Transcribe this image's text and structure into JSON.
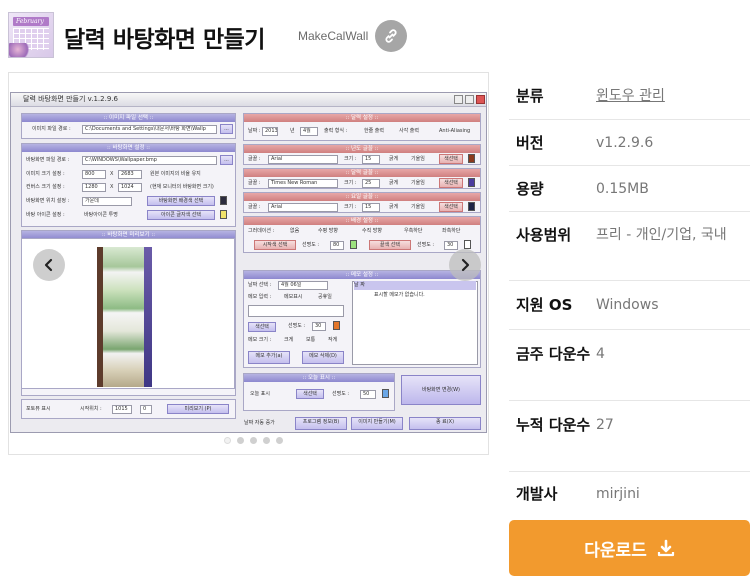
{
  "header": {
    "title": "달력 바탕화면 만들기",
    "subtitle": "MakeCalWall",
    "icon_month_text": "February"
  },
  "gallery": {
    "dot_count": 5,
    "active_dot": 0
  },
  "screenshot": {
    "window_title": "달력 바탕화면 만들기 v.1.2.9.6",
    "panel_image_file": ":: 이미지 파일 선택 ::",
    "image_file_label": "이미지 파일 경로 :",
    "image_file_path": "C:\\Documents and Settings\\내문서\\바탕 화면\\Wallp",
    "panel_wallpaper_settings": ":: 바탕화면 설정 ::",
    "wallpaper_file_label": "바탕화면 파일 경로 :",
    "wallpaper_file_path": "C:\\WINDOWS\\Wallpaper.bmp",
    "image_size_label": "이미지 크기 설정 :",
    "image_size_w": "800",
    "image_size_h": "2683",
    "keep_ratio": "원본 이미지의 비율 유지",
    "monitor_size_label": "컨버스 크기 설정 :",
    "monitor_size_w": "1280",
    "monitor_size_h": "1024",
    "monitor_note": "(현재 모니터의 바탕화면 크기)",
    "position_label": "바탕화면 위치 설정 :",
    "position_value": "가운데",
    "bg_color_btn": "바탕화면 배경색 선택",
    "icon_label": "바탕 아이콘 설정 :",
    "icon_transparent": "바탕아이콘 투명",
    "icon_color_btn": "아이콘 글자색 선택",
    "panel_preview": ":: 바탕화면 미리보기 ::",
    "preview_show": "포토뷰 표시",
    "start_pos_label": "시작위치 :",
    "start_pos_x": "1015",
    "start_pos_y": "0",
    "preview_btn": "미리보기 (P)",
    "panel_calendar": ":: 달력 설정 ::",
    "date_label": "날짜 :",
    "year": "2013",
    "year_unit": "년",
    "month": "4월",
    "output_label": "출력 형식 :",
    "single_output": "한줄 출력",
    "four_output": "사각 출력",
    "anti_alias": "Anti-Aliasing",
    "panel_year_font": ":: 년도 글꼴 ::",
    "panel_month_font": ":: 달력 글꼴 ::",
    "panel_day_font": ":: 요일 글꼴 ::",
    "font_label": "글꼴 :",
    "size_label": "크기 :",
    "font1": "Arial",
    "font2": "Times New Roman",
    "font3": "Arial",
    "size1": "15",
    "size2": "25",
    "size3": "15",
    "bold": "굵게",
    "italic": "기울임",
    "color_btn": "색선택",
    "panel_gradient": ":: 배경 설정 ::",
    "gradient_label": "그러데이션 :",
    "g_none": "없음",
    "g_horizontal": "수평 방향",
    "g_vertical": "수직 방향",
    "g_diag1": "우측하단",
    "g_diag2": "좌측하단",
    "start_color_btn": "시작색 선택",
    "end_color_btn": "끝색 선택",
    "opacity_label": "선명도 :",
    "opacity1": "80",
    "opacity2": "30",
    "panel_memo": ":: 메모 설정 ::",
    "date_select_label": "날짜 선택 :",
    "date_select_value": "4월 06일",
    "memo_input_label": "메모 입력 :",
    "memo_show": "메모표시",
    "holiday": "공휴일",
    "memo_list_header": "날 짜",
    "memo_list_header2": "메 모",
    "memo_list_empty": "표시할 메모가 없습니다.",
    "memo_color_btn": "색선택",
    "memo_opacity": "30",
    "memo_size_label": "메모 크기 :",
    "memo_size_small": "크게",
    "memo_size_mid": "보통",
    "memo_size_large": "작게",
    "memo_add_btn": "메모 추가(a)",
    "memo_del_btn": "메모 삭제(D)",
    "panel_today": ":: 오늘 표시 ::",
    "today_show": "오늘 표시",
    "today_color_btn": "색선택",
    "today_opacity": "50",
    "apply_btn": "바탕화면 변경(W)",
    "auto_date": "날짜 자동 증가",
    "program_info_btn": "프로그램 정보(B)",
    "make_image_btn": "이미지 만들기(M)",
    "close_btn": "종 료(X)"
  },
  "info": {
    "rows": [
      {
        "label": "분류",
        "value": "윈도우 관리",
        "link": true
      },
      {
        "label": "버전",
        "value": "v1.2.9.6"
      },
      {
        "label": "용량",
        "value": "0.15MB"
      },
      {
        "label": "사용범위",
        "value": "프리 - 개인/기업, 국내"
      },
      {
        "label": "지원 OS",
        "value": "Windows"
      },
      {
        "label": "금주 다운수",
        "value": "4"
      },
      {
        "label": "누적 다운수",
        "value": "27"
      },
      {
        "label": "개발사",
        "value": "mirjini"
      }
    ]
  },
  "download": {
    "label": "다운로드"
  },
  "colors": {
    "download_bg": "#f29a2e",
    "link_circle": "#a6a6a6",
    "label_text": "#111111",
    "value_text": "#777777"
  },
  "icons": {
    "link": "link-icon",
    "prev": "chevron-left-icon",
    "next": "chevron-right-icon",
    "download": "download-icon"
  }
}
